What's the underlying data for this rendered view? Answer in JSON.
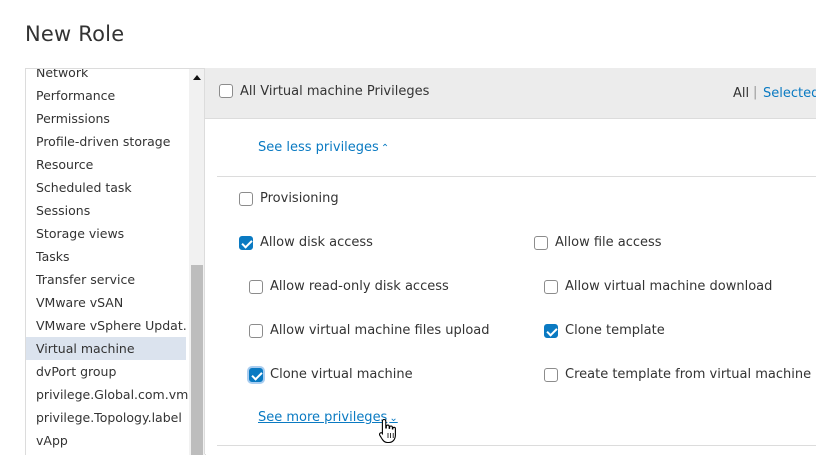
{
  "dialog": {
    "title": "New Role"
  },
  "left_list": {
    "items": [
      "Network",
      "Performance",
      "Permissions",
      "Profile-driven storage",
      "Resource",
      "Scheduled task",
      "Sessions",
      "Storage views",
      "Tasks",
      "Transfer service",
      "VMware vSAN",
      "VMware vSphere Updat...",
      "Virtual machine",
      "dvPort group",
      "privilege.Global.com.vm...",
      "privilege.Topology.label",
      "vApp"
    ],
    "selected": "Virtual machine"
  },
  "header": {
    "all_privileges_label": "All Virtual machine Privileges",
    "all_privileges_checked": false,
    "filter_all": "All",
    "filter_separator": "|",
    "filter_selected": "Selected"
  },
  "see_less": {
    "label": "See less privileges"
  },
  "privileges": {
    "provisioning": {
      "label": "Provisioning",
      "checked": false
    },
    "allow_disk_access": {
      "label": "Allow disk access",
      "checked": true
    },
    "allow_file_access": {
      "label": "Allow file access",
      "checked": false
    },
    "allow_readonly_disk_access": {
      "label": "Allow read-only disk access",
      "checked": false
    },
    "allow_vm_download": {
      "label": "Allow virtual machine download",
      "checked": false
    },
    "allow_vm_files_upload": {
      "label": "Allow virtual machine files upload",
      "checked": false
    },
    "clone_template": {
      "label": "Clone template",
      "checked": true
    },
    "clone_vm": {
      "label": "Clone virtual machine",
      "checked": true
    },
    "create_template_from_vm": {
      "label": "Create template from virtual machine",
      "checked": false
    }
  },
  "see_more": {
    "label": "See more privileges"
  }
}
